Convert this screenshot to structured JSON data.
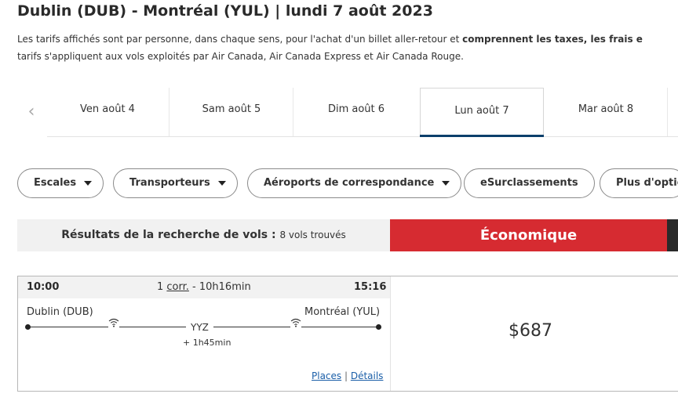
{
  "header": {
    "title": "Dublin (DUB) - Montréal (YUL) | lundi 7 août 2023",
    "desc_line1_a": "Les tarifs affichés sont par personne, dans chaque sens, pour l'achat d'un billet aller-retour et ",
    "desc_line1_b": "comprennent les taxes, les frais e",
    "desc_line2": "tarifs s'appliquent aux vols exploités par Air Canada, Air Canada Express et Air Canada Rouge."
  },
  "dates": [
    {
      "label": "Ven août 4"
    },
    {
      "label": "Sam août 5"
    },
    {
      "label": "Dim août 6"
    },
    {
      "label": "Lun août 7"
    },
    {
      "label": "Mar août 8"
    }
  ],
  "filters": {
    "stops": "Escales",
    "carriers": "Transporteurs",
    "airports": "Aéroports de correspondance",
    "upgrades": "eSurclassements",
    "more": "Plus d'optio"
  },
  "results": {
    "label": "Résultats de la recherche de vols : ",
    "count": "8 vols trouvés",
    "cabin": "Économique"
  },
  "flight": {
    "departure_time": "10:00",
    "arrival_time": "15:16",
    "stops_count": "1 ",
    "stops_abbr": "corr.",
    "duration": " - 10h16min",
    "origin": "Dublin (DUB)",
    "destination": "Montréal (YUL)",
    "connection_code": "YYZ",
    "connection_time": "+ 1h45min",
    "seats_link": "Places",
    "link_separator": " | ",
    "details_link": "Détails",
    "price": "$687"
  },
  "colors": {
    "brand_red": "#d62b31",
    "active_tab_underline": "#0c3f6b",
    "link_blue": "#1a5ea8"
  },
  "icons": {
    "prev_date": "chevron-left-icon",
    "dropdown": "caret-down-icon",
    "wifi": "wifi-icon"
  }
}
